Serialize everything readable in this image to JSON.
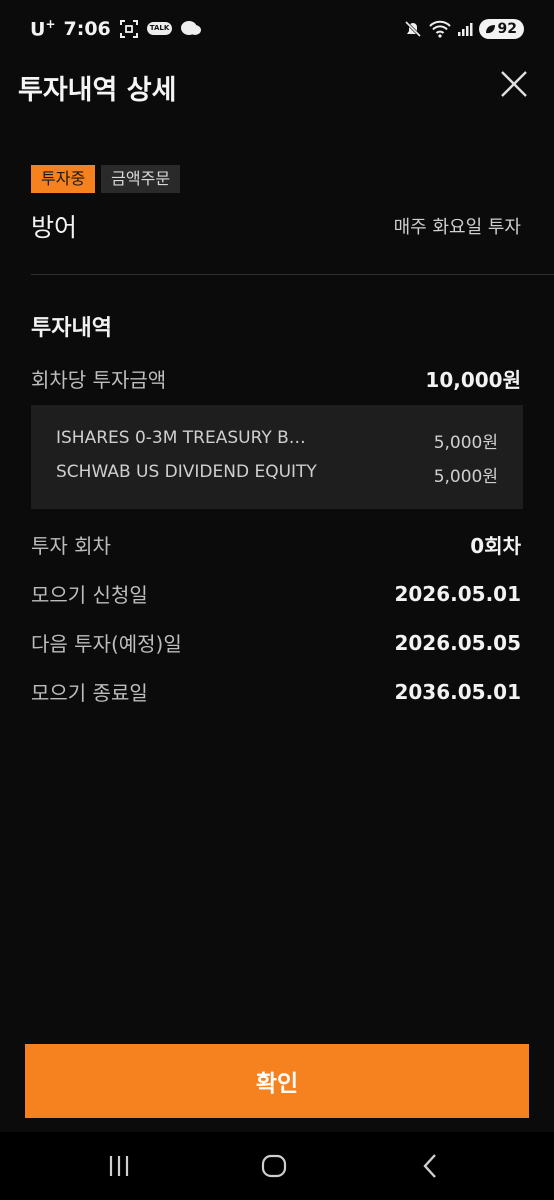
{
  "status_bar": {
    "carrier": "U",
    "carrier_sup": "+",
    "time": "7:06",
    "talk_badge": "TALK",
    "battery": "92"
  },
  "header": {
    "title": "투자내역 상세"
  },
  "plan": {
    "status_badge": "투자중",
    "type_badge": "금액주문",
    "name": "방어",
    "schedule": "매주 화요일 투자"
  },
  "history": {
    "section_title": "투자내역",
    "per_round_label": "회차당 투자금액",
    "per_round_value": "10,000원",
    "allocations": [
      {
        "name": "ISHARES 0-3M TREASURY B…",
        "amount": "5,000원"
      },
      {
        "name": "SCHWAB US DIVIDEND EQUITY",
        "amount": "5,000원"
      }
    ],
    "rows": [
      {
        "label": "투자 회차",
        "value": "0회차"
      },
      {
        "label": "모으기 신청일",
        "value": "2026.05.01"
      },
      {
        "label": "다음 투자(예정)일",
        "value": "2026.05.05"
      },
      {
        "label": "모으기 종료일",
        "value": "2036.05.01"
      }
    ]
  },
  "confirm_button": {
    "label": "확인"
  },
  "colors": {
    "accent": "#f5821f",
    "background": "#0b0b0b",
    "box": "#1e1e1e"
  }
}
